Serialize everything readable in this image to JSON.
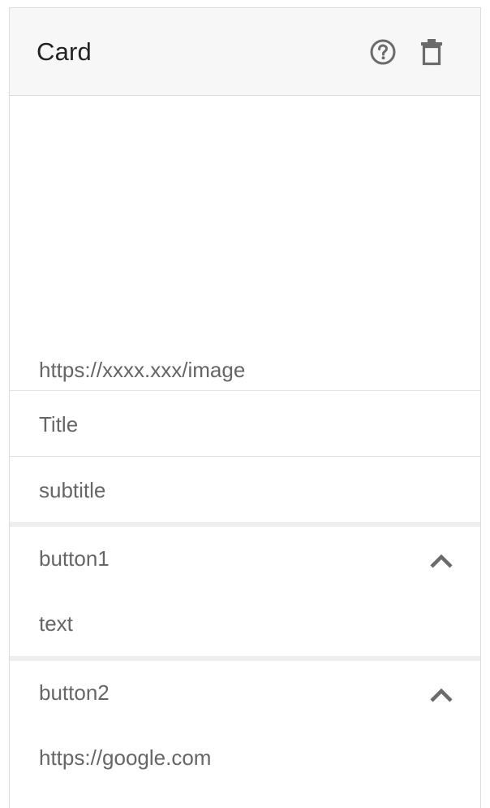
{
  "card": {
    "title": "Card",
    "image_url": "https://xxxx.xxx/image",
    "title_field": "Title",
    "subtitle_field": "subtitle"
  },
  "buttons": [
    {
      "label": "button1",
      "value": "text"
    },
    {
      "label": "button2",
      "value": "https://google.com"
    }
  ],
  "icons": {
    "help": "help-circle-icon",
    "delete": "trash-icon",
    "collapse": "chevron-up-icon"
  },
  "colors": {
    "header_bg": "#f7f7f7",
    "icon": "#6b6b6b",
    "text": "#666666"
  }
}
